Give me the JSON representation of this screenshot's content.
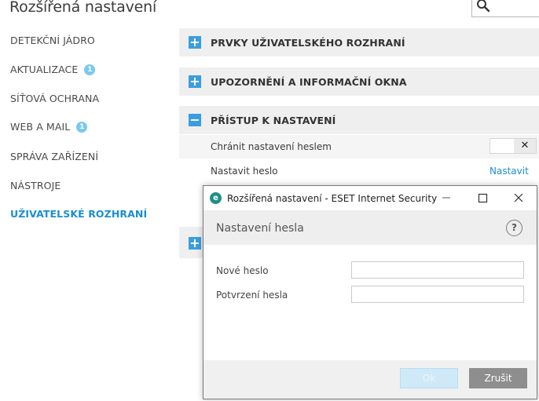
{
  "header": {
    "title": "Rozšířená nastavení"
  },
  "sidebar": {
    "items": [
      {
        "label": "DETEKČNÍ JÁDRO"
      },
      {
        "label": "AKTUALIZACE",
        "badge": "1"
      },
      {
        "label": "SÍŤOVÁ OCHRANA"
      },
      {
        "label": "WEB A MAIL",
        "badge": "1"
      },
      {
        "label": "SPRÁVA ZAŘÍZENÍ"
      },
      {
        "label": "NÁSTROJE"
      },
      {
        "label": "UŽIVATELSKÉ ROZHRANÍ",
        "active": true
      }
    ]
  },
  "sections": [
    {
      "title": "PRVKY UŽIVATELSKÉHO ROZHRANÍ",
      "toggle": "+"
    },
    {
      "title": "UPOZORNĚNÍ A INFORMAČNÍ OKNA",
      "toggle": "+"
    },
    {
      "title": "PŘÍSTUP K NASTAVENÍ",
      "toggle": "−"
    }
  ],
  "access_settings": {
    "protect_label": "Chránit nastavení heslem",
    "protect_toggle_icon": "✕",
    "set_password_label": "Nastavit heslo",
    "set_password_link": "Nastavit"
  },
  "collapsed_section_toggle": "+",
  "dialog": {
    "window_title": "Rozšířená nastavení - ESET Internet Security",
    "app_icon_letter": "e",
    "heading": "Nastavení hesla",
    "help_icon": "?",
    "new_password_label": "Nové heslo",
    "new_password_value": "",
    "confirm_password_label": "Potvrzení hesla",
    "confirm_password_value": "",
    "ok_label": "Ok",
    "cancel_label": "Zrušit"
  },
  "colors": {
    "accent": "#1a8fd2",
    "section_toggle": "#3a9ede",
    "badge": "#7cc8ef",
    "cancel_button": "#8e8e8e"
  }
}
